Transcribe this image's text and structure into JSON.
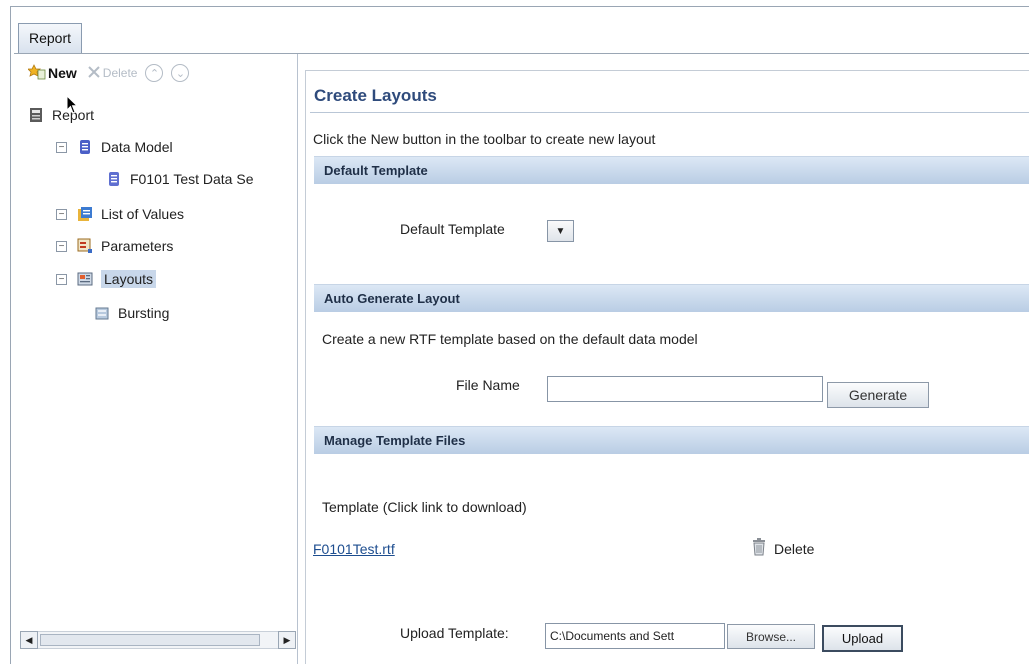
{
  "tab": {
    "label": "Report"
  },
  "toolbar": {
    "new_label": "New",
    "delete_label": "Delete"
  },
  "tree": {
    "root": "Report",
    "data_model": "Data Model",
    "dataset": "F0101 Test Data Se",
    "list_of_values": "List of Values",
    "parameters": "Parameters",
    "layouts": "Layouts",
    "bursting": "Bursting"
  },
  "main": {
    "title": "Create Layouts",
    "intro": "Click the New button in the toolbar to create new layout",
    "default_template_section": {
      "header": "Default Template",
      "label": "Default Template"
    },
    "auto_generate_section": {
      "header": "Auto Generate Layout",
      "description": "Create a new RTF template based on the default data model",
      "file_name_label": "File Name",
      "file_name_value": "",
      "generate_label": "Generate"
    },
    "manage_section": {
      "header": "Manage Template Files",
      "template_label": "Template (Click link to download)",
      "template_file": "F0101Test.rtf",
      "delete_label": "Delete",
      "upload_label": "Upload Template:",
      "upload_path": "C:\\Documents and Sett",
      "browse_label": "Browse...",
      "upload_button": "Upload"
    }
  }
}
